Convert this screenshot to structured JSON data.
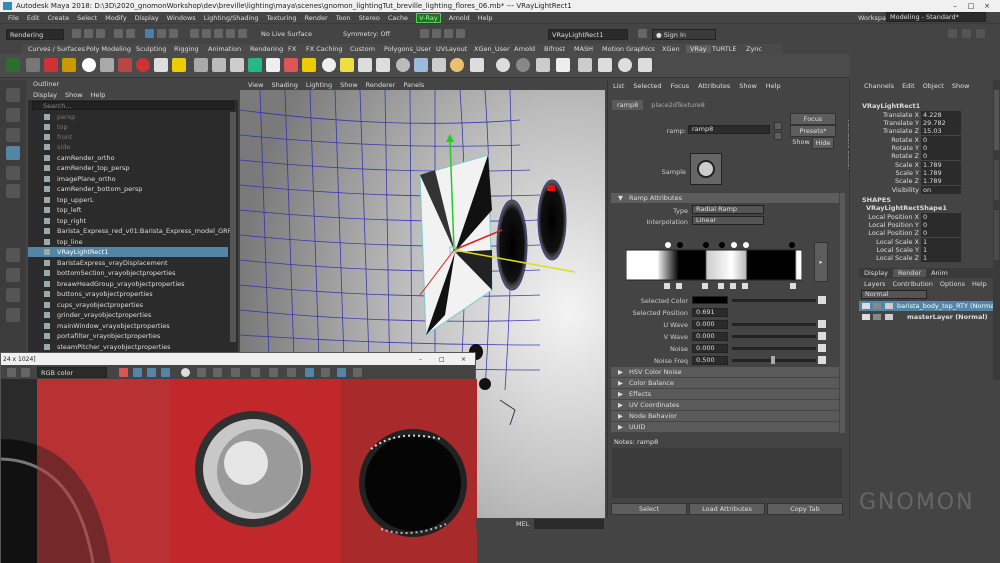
{
  "window": {
    "title": "Autodesk Maya 2018: D:\\3D\\2020_gnomonWorkshop\\dev\\breville\\lighting\\maya\\scenes\\gnomon_lightingTut_breville_lighting_flores_06.mb* --- VRayLightRect1"
  },
  "menu": [
    "File",
    "Edit",
    "Create",
    "Select",
    "Modify",
    "Display",
    "Windows",
    "Lighting/Shading",
    "Texturing",
    "Render",
    "Toon",
    "Stereo",
    "Cache",
    "V-Ray",
    "Arnold",
    "Help"
  ],
  "status": {
    "mode": "Rendering",
    "symmetry": "Symmetry: Off",
    "object_name": "VRayLightRect1",
    "signin": "Sign In",
    "workspace_label": "Workspace :",
    "workspace": "Modeling - Standard*",
    "live_surface": "No Live Surface"
  },
  "shelf_tabs": [
    "Curves / Surfaces",
    "Poly Modeling",
    "Sculpting",
    "Rigging",
    "Animation",
    "Rendering",
    "FX",
    "FX Caching",
    "Custom",
    "Polygons_User",
    "UVLayout",
    "XGen_User",
    "Arnold",
    "Bifrost",
    "MASH",
    "Motion Graphics",
    "XGen",
    "VRay",
    "TURTLE",
    "Zync"
  ],
  "outliner": {
    "title": "Outliner",
    "menu": [
      "Display",
      "Show",
      "Help"
    ],
    "search": "Search...",
    "items": [
      {
        "label": "persp",
        "dim": true
      },
      {
        "label": "top",
        "dim": true
      },
      {
        "label": "front",
        "dim": true
      },
      {
        "label": "side",
        "dim": true
      },
      {
        "label": "camRender_ortho"
      },
      {
        "label": "camRender_top_persp"
      },
      {
        "label": "imagePlane_ortho"
      },
      {
        "label": "camRender_bottom_persp"
      },
      {
        "label": "top_upperL"
      },
      {
        "label": "top_left"
      },
      {
        "label": "top_right"
      },
      {
        "label": "Barista_Express_red_v01:Barista_Express_model_GRP"
      },
      {
        "label": "top_line"
      },
      {
        "label": "VRayLightRect1",
        "selected": true
      },
      {
        "label": "BaristaExpress_vrayDisplacement"
      },
      {
        "label": "bottomSection_vrayobjectproperties"
      },
      {
        "label": "breawHeadGroup_vrayobjectproperties"
      },
      {
        "label": "buttons_vrayobjectproperties"
      },
      {
        "label": "cups_vrayobjectproperties"
      },
      {
        "label": "grinder_vrayobjectproperties"
      },
      {
        "label": "mainWindow_vrayobjectproperties"
      },
      {
        "label": "portafilter_vrayobjectproperties"
      },
      {
        "label": "steamPitcher_vrayobjectproperties"
      }
    ]
  },
  "viewport_menu": [
    "View",
    "Shading",
    "Lighting",
    "Show",
    "Renderer",
    "Panels"
  ],
  "texture_window": {
    "title": "24 x 1024]",
    "channel": "RGB color"
  },
  "attribute_editor": {
    "menu": [
      "List",
      "Selected",
      "Focus",
      "Attributes",
      "Show",
      "Help"
    ],
    "tabs": [
      "ramp8",
      "place2dTexture8"
    ],
    "ramp_label": "ramp:",
    "ramp_value": "ramp8",
    "focus": "Focus",
    "presets": "Presets*",
    "show": "Show",
    "hide": "Hide",
    "sample": "Sample",
    "ramp_section": "Ramp Attributes",
    "type_label": "Type",
    "type_value": "Radial Ramp",
    "interp_label": "Interpolation",
    "interp_value": "Linear",
    "selected_color": "Selected Color",
    "selected_position_label": "Selected Position",
    "selected_position": "0.691",
    "u_wave_label": "U Wave",
    "u_wave": "0.000",
    "v_wave_label": "V Wave",
    "v_wave": "0.000",
    "noise_label": "Noise",
    "noise": "0.000",
    "noise_freq_label": "Noise Freq",
    "noise_freq": "0.500",
    "sections": [
      "HSV Color Noise",
      "Color Balance",
      "Effects",
      "UV Coordinates",
      "Node Behavior",
      "UUID"
    ],
    "notes": "Notes:  ramp8",
    "btn_select": "Select",
    "btn_load": "Load Attributes",
    "btn_copy": "Copy Tab",
    "side_label": "Attribute Editor"
  },
  "channel_box": {
    "menu": [
      "Channels",
      "Edit",
      "Object",
      "Show"
    ],
    "object": "VRayLightRect1",
    "attrs": [
      [
        "Translate X",
        "4.228"
      ],
      [
        "Translate Y",
        "29.782"
      ],
      [
        "Translate Z",
        "15.03"
      ],
      [
        "Rotate X",
        "0"
      ],
      [
        "Rotate Y",
        "0"
      ],
      [
        "Rotate Z",
        "0"
      ],
      [
        "Scale X",
        "1.789"
      ],
      [
        "Scale Y",
        "1.789"
      ],
      [
        "Scale Z",
        "1.789"
      ],
      [
        "Visibility",
        "on"
      ]
    ],
    "shapes_label": "SHAPES",
    "shape": "VRayLightRectShape1",
    "shape_attrs": [
      [
        "Local Position X",
        "0"
      ],
      [
        "Local Position Y",
        "0"
      ],
      [
        "Local Position Z",
        "0"
      ],
      [
        "Local Scale X",
        "1"
      ],
      [
        "Local Scale Y",
        "1"
      ],
      [
        "Local Scale Z",
        "1"
      ]
    ]
  },
  "layer_editor": {
    "tabs": [
      "Display",
      "Render",
      "Anim"
    ],
    "menu": [
      "Layers",
      "Contribution",
      "Options",
      "Help"
    ],
    "blend": "Normal",
    "layers": [
      "barista_body_top_RTY (Norma",
      "masterLayer (Normal)"
    ]
  },
  "bottom": {
    "mel": "MEL"
  },
  "watermark": "GNOMON"
}
